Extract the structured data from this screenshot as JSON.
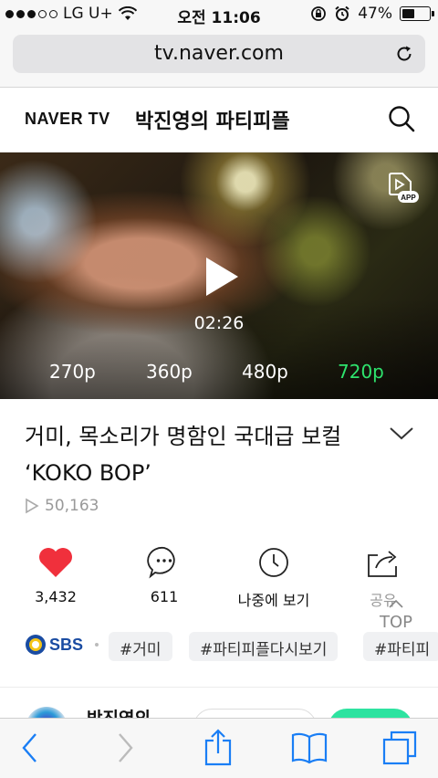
{
  "status_bar": {
    "carrier": "LG U+",
    "time": "오전 11:06",
    "battery": "47%",
    "battery_level": 0.47
  },
  "browser": {
    "url": "tv.naver.com"
  },
  "header": {
    "logo": "NAVER TV",
    "channel_title": "박진영의 파티피플"
  },
  "video": {
    "duration": "02:26",
    "qualities": [
      "270p",
      "360p",
      "480p",
      "720p"
    ],
    "selected_quality": "720p",
    "app_badge": "APP"
  },
  "clip": {
    "title_line1": "거미, 목소리가 명함인 국대급 보컬",
    "title_line2": "‘KOKO BOP’",
    "views": "50,163"
  },
  "actions": {
    "like_count": "3,432",
    "comment_count": "611",
    "watch_later_label": "나중에 보기",
    "share_label": "공유"
  },
  "top_button": "TOP",
  "broadcaster": "SBS",
  "tags": [
    "#거미",
    "#파티피플다시보기",
    "#파티피"
  ],
  "channel": {
    "name": "박진영의"
  },
  "colors": {
    "accent_green": "#2ee36d",
    "like_red": "#f0303c",
    "toolbar_blue": "#1a7ef5"
  }
}
